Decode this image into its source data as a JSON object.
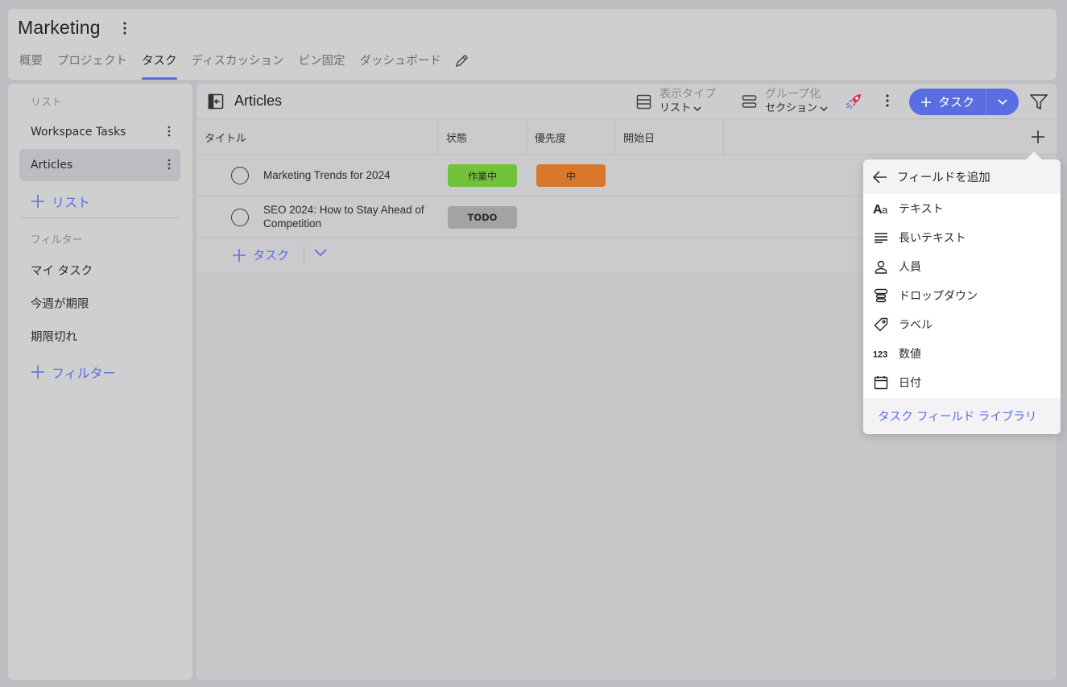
{
  "header": {
    "title": "Marketing",
    "tabs": [
      {
        "label": "概要"
      },
      {
        "label": "プロジェクト"
      },
      {
        "label": "タスク"
      },
      {
        "label": "ディスカッション"
      },
      {
        "label": "ピン固定"
      },
      {
        "label": "ダッシュボード"
      }
    ],
    "active_tab": "タスク"
  },
  "sidebar": {
    "lists_heading": "リスト",
    "lists": [
      {
        "label": "Workspace Tasks"
      },
      {
        "label": "Articles"
      }
    ],
    "selected_list": "Articles",
    "add_list_label": "リスト",
    "filters_heading": "フィルター",
    "filters": [
      {
        "label": "マイ タスク"
      },
      {
        "label": "今週が期限"
      },
      {
        "label": "期限切れ"
      }
    ],
    "add_filter_label": "フィルター"
  },
  "toolbar": {
    "title": "Articles",
    "view_type_label": "表示タイプ",
    "view_type_value": "リスト",
    "group_label": "グループ化",
    "group_value": "セクション",
    "add_task_label": "タスク"
  },
  "table": {
    "columns": [
      {
        "label": "タイトル"
      },
      {
        "label": "状態"
      },
      {
        "label": "優先度"
      },
      {
        "label": "開始日"
      }
    ],
    "rows": [
      {
        "title": "Marketing Trends for 2024",
        "status": "作業中",
        "priority": "中"
      },
      {
        "title": "SEO 2024: How to Stay Ahead of Competition",
        "status": "TODO",
        "priority": ""
      }
    ],
    "add_task_label": "タスク"
  },
  "add_field_menu": {
    "title": "フィールドを追加",
    "items": [
      {
        "label": "テキスト",
        "icon": "text-format-icon"
      },
      {
        "label": "長いテキスト",
        "icon": "long-text-icon"
      },
      {
        "label": "人員",
        "icon": "person-icon"
      },
      {
        "label": "ドロップダウン",
        "icon": "dropdown-icon"
      },
      {
        "label": "ラベル",
        "icon": "tag-icon"
      },
      {
        "label": "数値",
        "icon": "number-icon"
      },
      {
        "label": "日付",
        "icon": "calendar-icon"
      }
    ],
    "footer_link": "タスク フィールド ライブラリ"
  },
  "colors": {
    "accent": "#5b6ee1",
    "status_in_progress": "#72c23a",
    "status_todo": "#a3a3a6",
    "priority_medium": "#d9782d"
  }
}
